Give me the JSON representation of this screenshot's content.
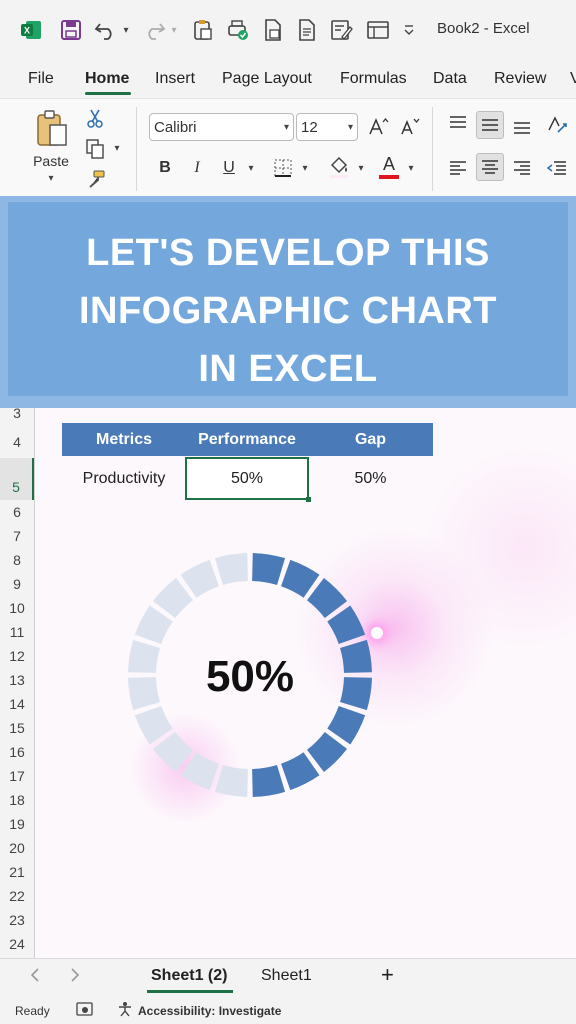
{
  "app": {
    "title": "Book2  -  Excel"
  },
  "tabs": [
    "File",
    "Home",
    "Insert",
    "Page Layout",
    "Formulas",
    "Data",
    "Review",
    "V"
  ],
  "ribbon": {
    "paste_label": "Paste",
    "font_name": "Calibri",
    "font_size": "12",
    "bold": "B",
    "italic": "I",
    "underline": "U",
    "font_color_glyph": "A",
    "grow_font": "A^",
    "shrink_font": "A˅"
  },
  "banner": {
    "line1": "LET'S DEVELOP THIS",
    "line2": "INFOGRAPHIC CHART",
    "line3": "IN EXCEL"
  },
  "rows": [
    "3",
    "4",
    "5",
    "6",
    "7",
    "8",
    "9",
    "10",
    "11",
    "12",
    "13",
    "14",
    "15",
    "16",
    "17",
    "18",
    "19",
    "20",
    "21",
    "22",
    "23",
    "24"
  ],
  "table": {
    "headers": [
      "Metrics",
      "Performance",
      "Gap"
    ],
    "row": [
      "Productivity",
      "50%",
      "50%"
    ]
  },
  "chart_data": {
    "type": "pie",
    "title": "",
    "categories": [
      "Performance",
      "Gap"
    ],
    "values": [
      50,
      50
    ],
    "center_label": "50%",
    "segments": 20,
    "colors": {
      "filled": "#4a7ab8",
      "empty": "#dce3ee"
    }
  },
  "sheets": {
    "active": "Sheet1 (2)",
    "other": "Sheet1",
    "add": "+"
  },
  "status": {
    "ready": "Ready",
    "accessibility": "Accessibility: Investigate"
  },
  "colors": {
    "accent": "#1e7145",
    "header": "#4a7ab8",
    "banner": "#74a8dc"
  }
}
